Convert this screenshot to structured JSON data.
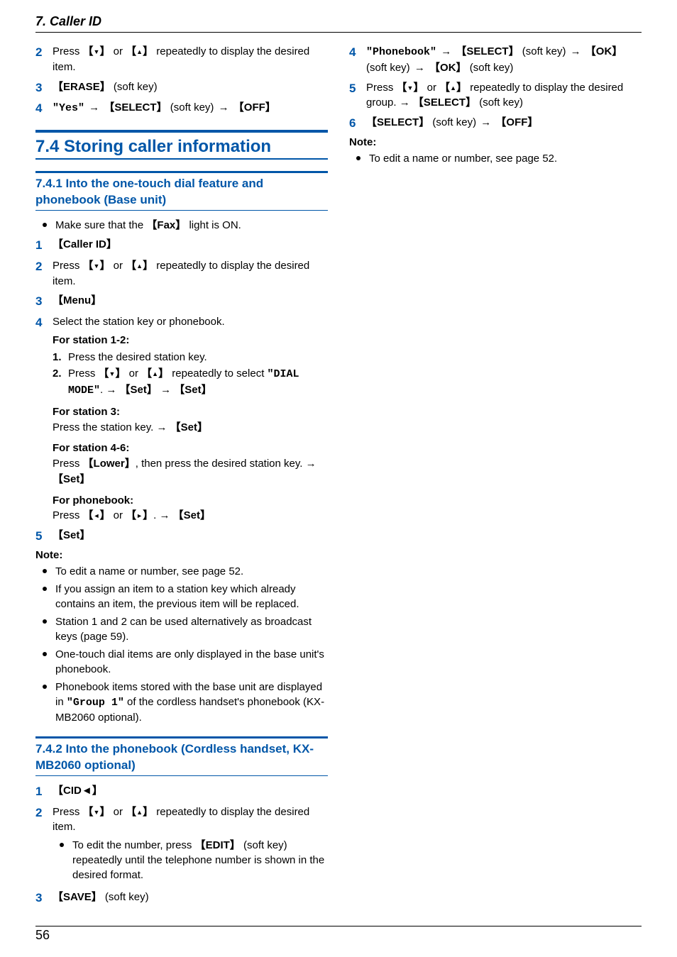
{
  "header": {
    "chapter": "7.",
    "title": "Caller ID"
  },
  "left": {
    "top_steps": {
      "s2_label": "2",
      "s2_a": "Press ",
      "s2_b": " or ",
      "s2_c": " repeatedly to display the desired item.",
      "s3_label": "3",
      "s3_erase": "ERASE",
      "s3_softkey": " (soft key)",
      "s4_label": "4",
      "s4_yes": "\"Yes\"",
      "s4_arrow": " → ",
      "s4_select": "SELECT",
      "s4_softkey": " (soft key) ",
      "s4_arrow2": "→ ",
      "s4_off": "OFF"
    },
    "section_7_4": "7.4 Storing caller information",
    "sub_741": "7.4.1 Into the one-touch dial feature and phonebook (Base unit)",
    "pre_bullet": "Make sure that the ",
    "pre_fax": "Fax",
    "pre_bullet2": " light is ON.",
    "s741": {
      "s1_label": "1",
      "s1_text": "Caller ID",
      "s2_label": "2",
      "s2_a": "Press ",
      "s2_b": " or ",
      "s2_c": " repeatedly to display the desired item.",
      "s3_label": "3",
      "s3_text": "Menu",
      "s4_label": "4",
      "s4_a": "Select the station key or phonebook.",
      "s4_h1": "For station 1-2:",
      "s4_h1_s1_label": "1.",
      "s4_h1_s1": "Press the desired station key.",
      "s4_h1_s2_label": "2.",
      "s4_h1_s2a": "Press ",
      "s4_h1_s2b": " or ",
      "s4_h1_s2c": " repeatedly to select ",
      "s4_h1_s2d": "\"DIAL MODE\"",
      "s4_h1_s2e": ". → ",
      "s4_h1_set1": "Set",
      "s4_h1_arr": " → ",
      "s4_h1_set2": "Set",
      "s4_h2": "For station 3:",
      "s4_h2_a": "Press the station key. → ",
      "s4_h2_set": "Set",
      "s4_h3": "For station 4-6:",
      "s4_h3_a": "Press ",
      "s4_h3_lower": "Lower",
      "s4_h3_b": ", then press the desired station key. → ",
      "s4_h3_set": "Set",
      "s4_h4": "For phonebook:",
      "s4_h4_a": "Press ",
      "s4_h4_b": " or ",
      "s4_h4_c": ". → ",
      "s4_h4_set": "Set",
      "s5_label": "5",
      "s5_text": "Set"
    },
    "note_label": "Note:",
    "notes741": {
      "n1": "To edit a name or number, see page 52.",
      "n2": "If you assign an item to a station key which already contains an item, the previous item will be replaced.",
      "n3": "Station 1 and 2 can be used alternatively as broadcast keys (page 59).",
      "n4": "One-touch dial items are only displayed in the base unit's phonebook.",
      "n5a": "Phonebook items stored with the base unit are displayed in ",
      "n5b": "\"Group 1\"",
      "n5c": " of the cordless handset's phonebook (KX-MB2060 optional)."
    },
    "sub_742": "7.4.2 Into the phonebook (Cordless handset, KX-MB2060 optional)",
    "s742": {
      "s1_label": "1",
      "s1_text": "CID◄",
      "s2_label": "2",
      "s2_a": "Press ",
      "s2_b": " or ",
      "s2_c": " repeatedly to display the desired item.",
      "s2_bul_a": "To edit the number, press ",
      "s2_bul_edit": "EDIT",
      "s2_bul_b": " (soft key) repeatedly until the telephone number is shown in the desired format.",
      "s3_label": "3",
      "s3_text": "SAVE",
      "s3_softkey": " (soft key)"
    }
  },
  "right": {
    "s4_label": "4",
    "s4_pb": "\"Phonebook\"",
    "s4_arr1": " → ",
    "s4_select": "SELECT",
    "s4_sk1": " (soft key) ",
    "s4_arr2": "→ ",
    "s4_ok1": "OK",
    "s4_sk2": " (soft key) ",
    "s4_arr3": "→ ",
    "s4_ok2": "OK",
    "s4_sk3": " (soft key)",
    "s5_label": "5",
    "s5_a": "Press ",
    "s5_b": " or ",
    "s5_c": " repeatedly to display the desired group. → ",
    "s5_select": "SELECT",
    "s5_sk": " (soft key)",
    "s6_label": "6",
    "s6_select": "SELECT",
    "s6_sk": " (soft key) ",
    "s6_arr": "→ ",
    "s6_off": "OFF",
    "note_label": "Note:",
    "note1": "To edit a name or number, see page 52."
  },
  "footer": {
    "page": "56"
  },
  "glyph": {
    "down": "▼",
    "up": "▲",
    "left": "◄",
    "right": "►",
    "lbrk": "【",
    "rbrk": "】"
  }
}
